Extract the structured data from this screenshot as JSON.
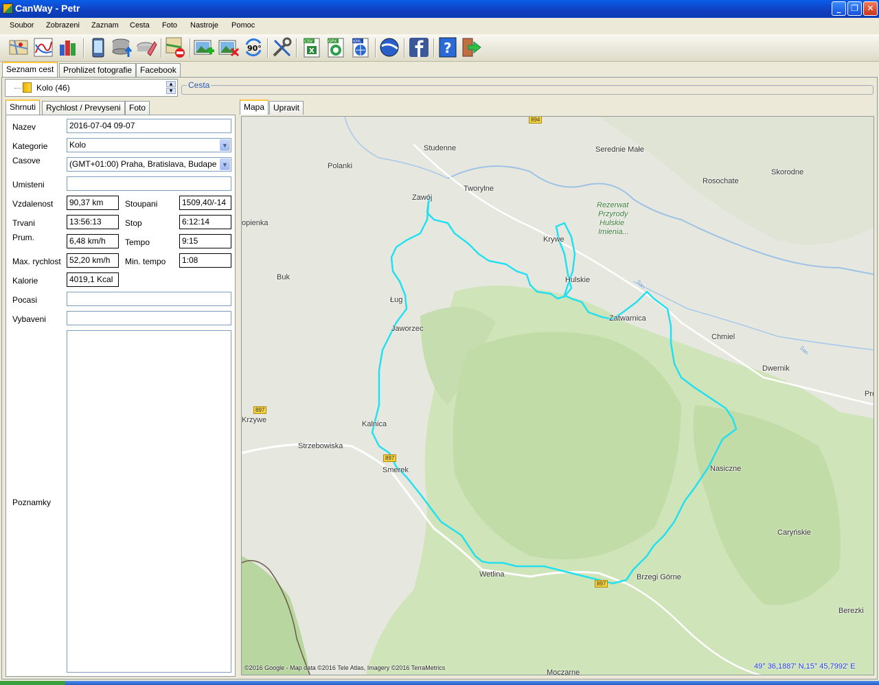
{
  "window": {
    "title": "CanWay - Petr"
  },
  "menu": [
    "Soubor",
    "Zobrazeni",
    "Zaznam",
    "Cesta",
    "Foto",
    "Nastroje",
    "Pomoc"
  ],
  "toolbar": {
    "csv": "CSV",
    "gpx": "GPX",
    "kml": "KML",
    "rotate": "90°",
    "icons": [
      "map-icon",
      "chart-icon",
      "bar-chart-icon",
      "phone-icon",
      "database-upload-icon",
      "eraser-icon",
      "map-delete-icon",
      "add-photo-icon",
      "remove-photo-icon",
      "rotate-icon",
      "tools-icon",
      "export-csv-icon",
      "export-gpx-icon",
      "export-kml-icon",
      "google-earth-icon",
      "facebook-icon",
      "help-icon",
      "exit-icon"
    ]
  },
  "main_tabs": [
    "Seznam cest",
    "Prohlizet fotografie",
    "Facebook"
  ],
  "tree": {
    "item": "Kolo (46)"
  },
  "cesta_label": "Cesta",
  "left_tabs": [
    "Shrnuti",
    "Rychlost / Prevyseni",
    "Foto"
  ],
  "right_tabs": [
    "Mapa",
    "Upravit"
  ],
  "form": {
    "nazev_label": "Nazev",
    "nazev": "2016-07-04 09-07",
    "kategorie_label": "Kategorie",
    "kategorie": "Kolo",
    "casove_label": "Casove",
    "casove": "(GMT+01:00) Praha, Bratislava, Budape",
    "umisteni_label": "Umisteni",
    "umisteni": "",
    "vzdalenost_label": "Vzdalenost",
    "vzdalenost": "90,37 km",
    "stoupani_label": "Stoupani",
    "stoupani": "1509,40/-14",
    "trvani_label": "Trvani",
    "trvani": "13:56:13",
    "stop_label": "Stop",
    "stop": "6:12:14",
    "prum_label": "Prum.",
    "prum": "6,48 km/h",
    "tempo_label": "Tempo",
    "tempo": "9:15",
    "maxrychlost_label": "Max. rychlost",
    "maxrychlost": "52,20 km/h",
    "mintempo_label": "Min. tempo",
    "mintempo": "1:08",
    "kalorie_label": "Kalorie",
    "kalorie": "4019,1 Kcal",
    "pocasi_label": "Pocasi",
    "pocasi": "",
    "vybaveni_label": "Vybaveni",
    "vybaveni": "",
    "poznamky_label": "Poznamky",
    "poznamky": ""
  },
  "map": {
    "places": [
      "Studenne",
      "Serednie Małe",
      "Polanki",
      "Tworylne",
      "Skorodne",
      "Rosochate",
      "Zawój",
      "Rezerwat",
      "Przyrody",
      "Hulskie",
      "Imienia...",
      "opienka",
      "Krywe",
      "Buk",
      "Hulskie",
      "Ług",
      "Jaworzec",
      "Zatwarnica",
      "Chmiel",
      "Dwernik",
      "Proc",
      "Krzywe",
      "Kalnica",
      "Strzebowiska",
      "Smerek",
      "Nasiczne",
      "Caryńskie",
      "Wetlina",
      "Brzegi Górne",
      "Berezki",
      "Moczarne",
      "San",
      "San"
    ],
    "roads": [
      "894",
      "897",
      "897",
      "897"
    ],
    "copyright": "©2016 Google - Map data ©2016 Tele Atlas, Imagery ©2016 TerraMetrics",
    "coords": "49° 36,1887' N,15° 45,7992' E"
  },
  "colors": {
    "track": "#22e0f0",
    "titlebar": "#0a5ee8",
    "statusbar": "#3b78d8"
  }
}
